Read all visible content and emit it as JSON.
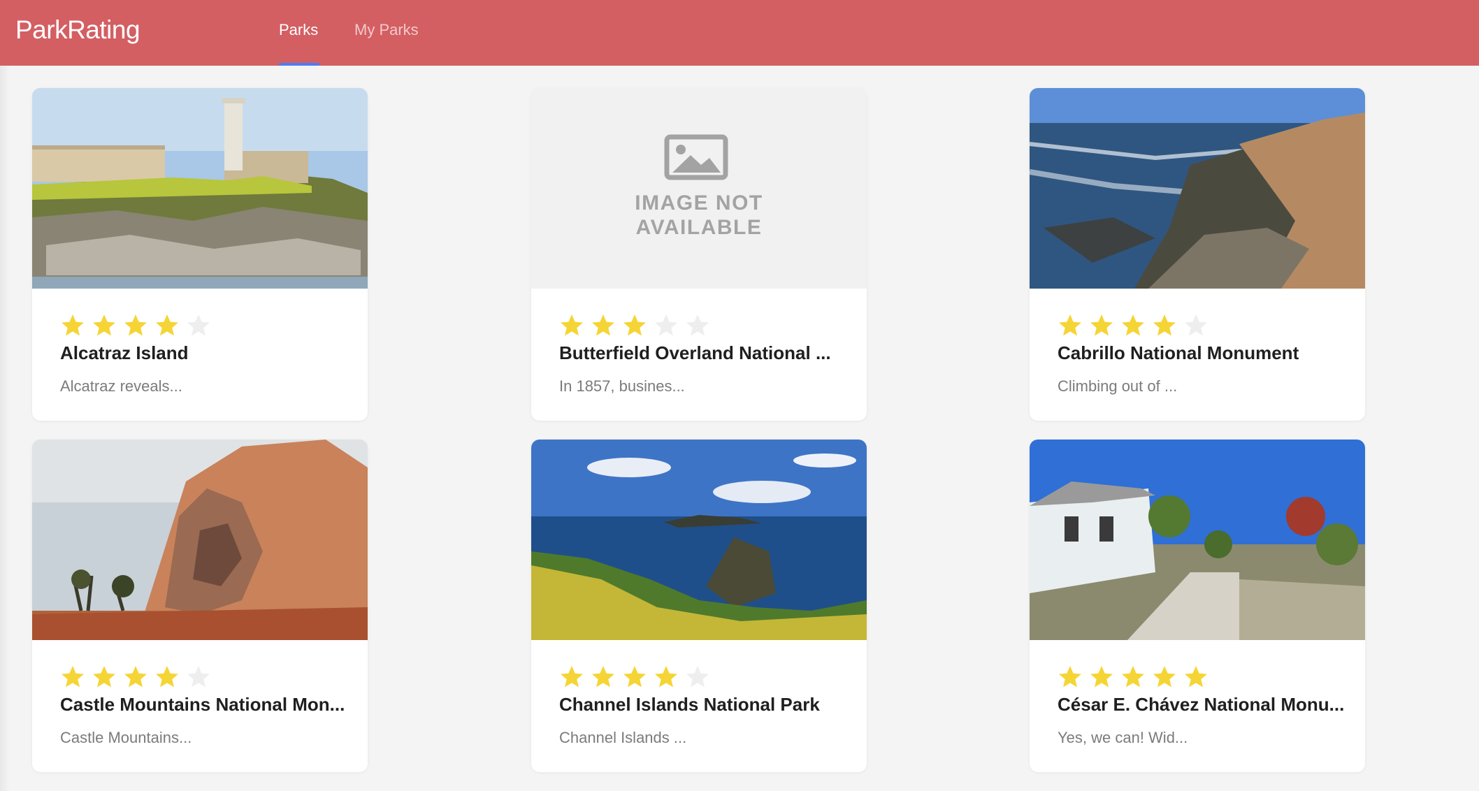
{
  "app": {
    "brand": "ParkRating"
  },
  "nav": {
    "tabs": [
      {
        "label": "Parks",
        "active": true
      },
      {
        "label": "My Parks",
        "active": false
      }
    ]
  },
  "colors": {
    "navbar": "#d35f63",
    "active_underline": "#4c7cf2",
    "star_filled": "#f5d535",
    "star_empty": "#eeeeee"
  },
  "parks": [
    {
      "name": "Alcatraz Island",
      "description": "Alcatraz reveals...",
      "rating": 4,
      "image": "alcatraz-photo"
    },
    {
      "name": "Butterfield Overland National ...",
      "description": "In 1857, busines...",
      "rating": 3,
      "image": "image-not-available",
      "placeholder_line1": "IMAGE NOT",
      "placeholder_line2": "AVAILABLE"
    },
    {
      "name": "Cabrillo National Monument",
      "description": "Climbing out of ...",
      "rating": 4,
      "image": "cabrillo-photo"
    },
    {
      "name": "Castle Mountains National Mon...",
      "description": "Castle Mountains...",
      "rating": 4,
      "image": "castle-mountains-photo"
    },
    {
      "name": "Channel Islands National Park",
      "description": "Channel Islands ...",
      "rating": 4,
      "image": "channel-islands-photo"
    },
    {
      "name": "César E. Chávez National Monu...",
      "description": "Yes, we can! Wid...",
      "rating": 5,
      "image": "cesar-chavez-photo"
    }
  ]
}
